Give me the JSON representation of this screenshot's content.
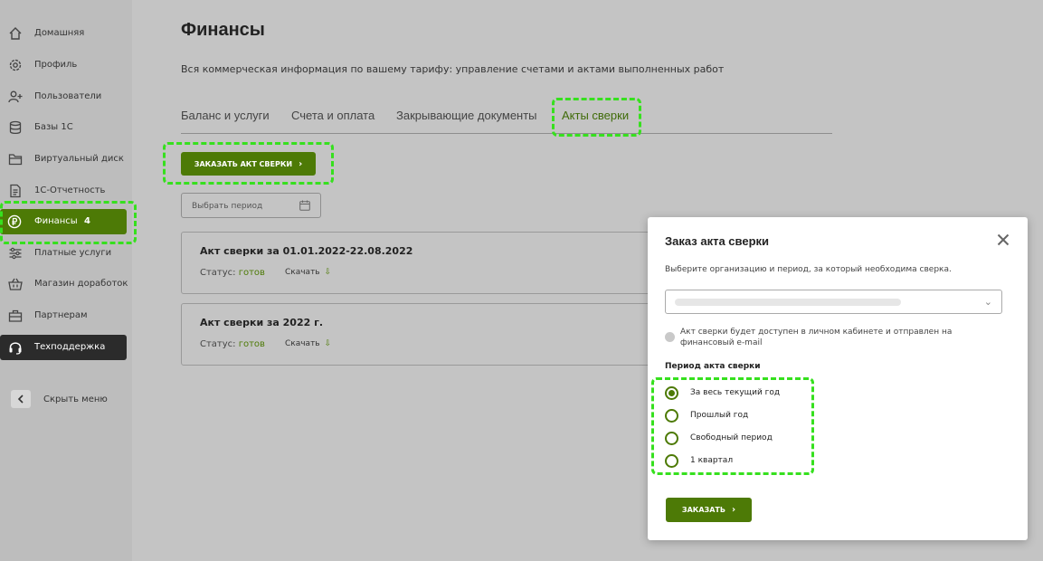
{
  "sidebar": {
    "items": [
      {
        "label": "Домашняя",
        "icon": "home-icon"
      },
      {
        "label": "Профиль",
        "icon": "gear-icon"
      },
      {
        "label": "Пользователи",
        "icon": "add-user-icon"
      },
      {
        "label": "Базы 1С",
        "icon": "database-icon"
      },
      {
        "label": "Виртуальный диск",
        "icon": "folder-icon"
      },
      {
        "label": "1С-Отчетность",
        "icon": "document-icon"
      },
      {
        "label": "Финансы",
        "icon": "ruble-icon",
        "badge": "4"
      },
      {
        "label": "Платные услуги",
        "icon": "sliders-icon"
      },
      {
        "label": "Магазин доработок",
        "icon": "basket-icon"
      },
      {
        "label": "Партнерам",
        "icon": "briefcase-icon"
      },
      {
        "label": "Техподдержка",
        "icon": "headset-icon"
      }
    ],
    "hide_menu": "Скрыть меню"
  },
  "page": {
    "title": "Финансы",
    "subtitle": "Вся коммерческая информация по вашему тарифу: управление счетами и актами выполненных работ"
  },
  "tabs": [
    "Баланс и услуги",
    "Счета и оплата",
    "Закрывающие документы",
    "Акты сверки"
  ],
  "order_button": "ЗАКАЗАТЬ АКТ СВЕРКИ",
  "period_placeholder": "Выбрать период",
  "acts": [
    {
      "title": "Акт сверки за 01.01.2022-22.08.2022",
      "status_label": "Статус:",
      "status": "готов",
      "download": "Скачать"
    },
    {
      "title": "Акт сверки за 2022 г.",
      "status_label": "Статус:",
      "status": "готов",
      "download": "Скачать"
    }
  ],
  "modal": {
    "title": "Заказ акта сверки",
    "description": "Выберите организацию и период, за который необходима сверка.",
    "note": "Акт сверки будет доступен в личном кабинете и отправлен на финансовый e-mail",
    "section_label": "Период акта сверки",
    "options": [
      {
        "label": "За весь текущий год",
        "selected": true
      },
      {
        "label": "Прошлый год",
        "selected": false
      },
      {
        "label": "Свободный период",
        "selected": false
      },
      {
        "label": "1 квартал",
        "selected": false
      }
    ],
    "submit": "ЗАКАЗАТЬ"
  },
  "colors": {
    "accent": "#4d7a06",
    "highlight": "#36e01e"
  }
}
